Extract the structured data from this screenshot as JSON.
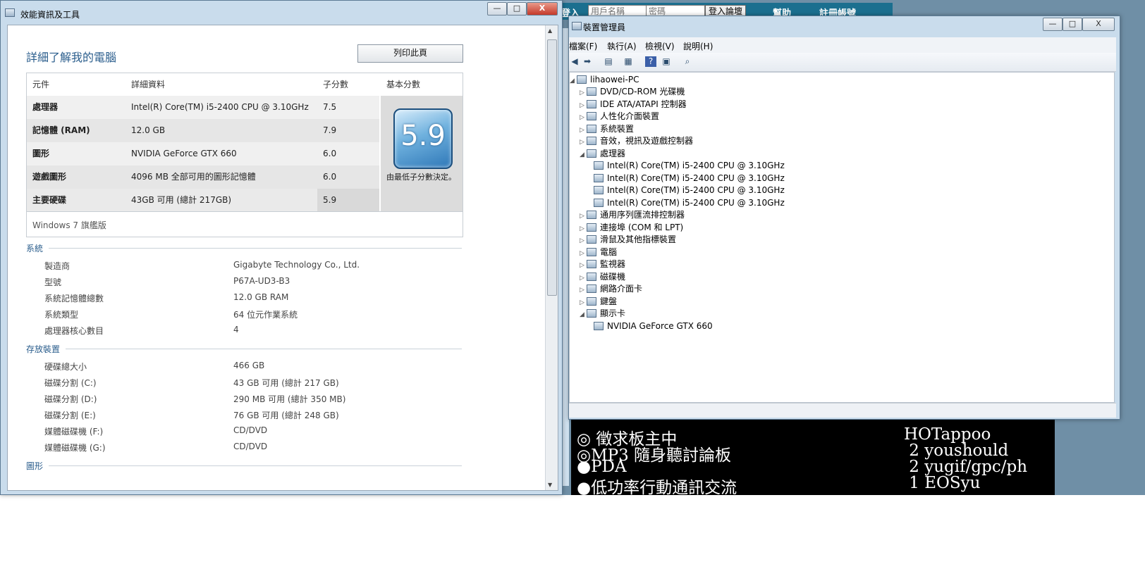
{
  "web": {
    "login_label": "登入",
    "user_placeholder": "用戶名稱",
    "pass_placeholder": "密碼",
    "login_button": "登入論壇",
    "help": "幫助",
    "register": "註冊帳號"
  },
  "terminal": {
    "rows": [
      {
        "left": "◎ 徵求板主中",
        "right": "HOTappoo"
      },
      {
        "left": "◎MP3 隨身聽討論板",
        "right": " 2 youshould"
      },
      {
        "left": "●PDA",
        "right": " 2 yugif/gpc/ph"
      },
      {
        "left": "●低功率行動通訊交流",
        "right": " 1 EOSyu"
      }
    ]
  },
  "perf": {
    "title": "效能資訊及工具",
    "controls": {
      "minimize": "—",
      "maximize": "□",
      "close": "X"
    },
    "heading": "詳細了解我的電腦",
    "print": "列印此頁",
    "table": {
      "headers": [
        "元件",
        "詳細資料",
        "子分數",
        "基本分數"
      ],
      "rows": [
        {
          "component": "處理器",
          "detail": "Intel(R) Core(TM) i5-2400 CPU @ 3.10GHz",
          "score": "7.5"
        },
        {
          "component": "記憶體 (RAM)",
          "detail": "12.0 GB",
          "score": "7.9"
        },
        {
          "component": "圖形",
          "detail": "NVIDIA GeForce GTX 660",
          "score": "6.0"
        },
        {
          "component": "遊戲圖形",
          "detail": "4096 MB 全部可用的圖形記憶體",
          "score": "6.0"
        },
        {
          "component": "主要硬碟",
          "detail": "43GB 可用 (總計 217GB)",
          "score": "5.9"
        }
      ],
      "base_score": "5.9",
      "base_note": "由最低子分數決定。",
      "edition": "Windows 7 旗艦版"
    },
    "system": {
      "title": "系統",
      "items": [
        {
          "label": "製造商",
          "value": "Gigabyte Technology Co., Ltd."
        },
        {
          "label": "型號",
          "value": "P67A-UD3-B3"
        },
        {
          "label": "系統記憶體總數",
          "value": "12.0 GB RAM"
        },
        {
          "label": "系統類型",
          "value": "64 位元作業系統"
        },
        {
          "label": "處理器核心數目",
          "value": "4"
        }
      ]
    },
    "storage": {
      "title": "存放裝置",
      "items": [
        {
          "label": "硬碟總大小",
          "value": "466 GB"
        },
        {
          "label": "磁碟分割 (C:)",
          "value": "43 GB 可用 (總計 217 GB)"
        },
        {
          "label": "磁碟分割 (D:)",
          "value": "290 MB 可用 (總計 350 MB)"
        },
        {
          "label": "磁碟分割 (E:)",
          "value": "76 GB 可用 (總計 248 GB)"
        },
        {
          "label": "媒體磁碟機 (F:)",
          "value": "CD/DVD"
        },
        {
          "label": "媒體磁碟機 (G:)",
          "value": "CD/DVD"
        }
      ]
    },
    "graphics_title": "圖形"
  },
  "devmgr": {
    "title": "裝置管理員",
    "menu": [
      "檔案(F)",
      "執行(A)",
      "檢視(V)",
      "說明(H)"
    ],
    "root": "lihaowei-PC",
    "categories": [
      "DVD/CD-ROM 光碟機",
      "IDE ATA/ATAPI 控制器",
      "人性化介面裝置",
      "系統裝置",
      "音效，視訊及遊戲控制器",
      "處理器",
      "通用序列匯流排控制器",
      "連接埠 (COM 和 LPT)",
      "滑鼠及其他指標裝置",
      "電腦",
      "監視器",
      "磁碟機",
      "網路介面卡",
      "鍵盤",
      "顯示卡"
    ],
    "processors": [
      "Intel(R) Core(TM) i5-2400 CPU @ 3.10GHz",
      "Intel(R) Core(TM) i5-2400 CPU @ 3.10GHz",
      "Intel(R) Core(TM) i5-2400 CPU @ 3.10GHz",
      "Intel(R) Core(TM) i5-2400 CPU @ 3.10GHz"
    ],
    "display_adapter": "NVIDIA GeForce GTX 660"
  }
}
